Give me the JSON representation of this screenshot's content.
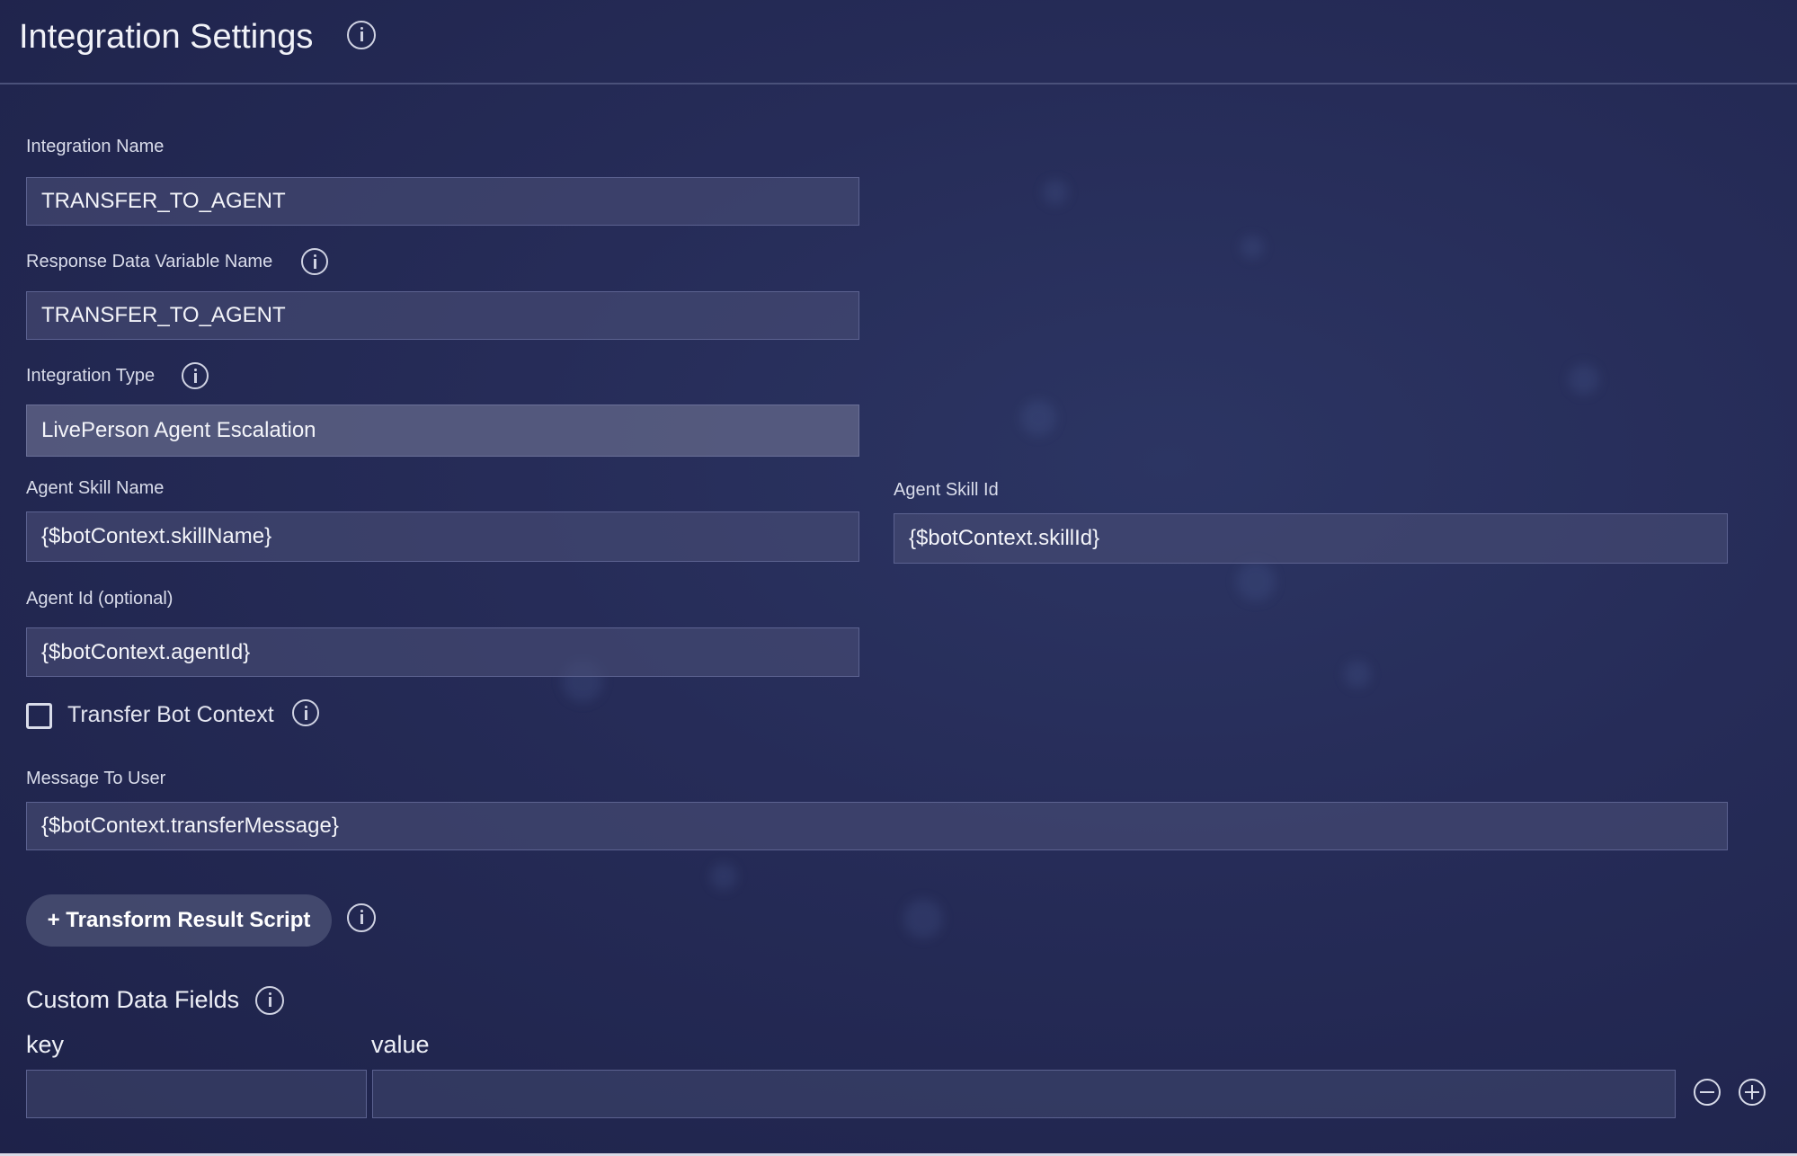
{
  "header": {
    "title": "Integration Settings"
  },
  "form": {
    "integration_name": {
      "label": "Integration Name",
      "value": "TRANSFER_TO_AGENT"
    },
    "response_variable": {
      "label": "Response Data Variable Name",
      "value": "TRANSFER_TO_AGENT"
    },
    "integration_type": {
      "label": "Integration Type",
      "value": "LivePerson Agent Escalation"
    },
    "agent_skill_name": {
      "label": "Agent Skill Name",
      "value": "{$botContext.skillName}"
    },
    "agent_skill_id": {
      "label": "Agent Skill Id",
      "value": "{$botContext.skillId}"
    },
    "agent_id": {
      "label": "Agent Id (optional)",
      "value": "{$botContext.agentId}"
    },
    "transfer_bot_context": {
      "label": "Transfer Bot Context",
      "checked": false
    },
    "message_to_user": {
      "label": "Message To User",
      "value": "{$botContext.transferMessage}"
    },
    "transform_button": {
      "label": "+ Transform Result Script"
    }
  },
  "custom_fields": {
    "title": "Custom Data Fields",
    "key_header": "key",
    "value_header": "value",
    "rows": [
      {
        "key": "",
        "value": ""
      }
    ]
  },
  "colors": {
    "background": "#262c58",
    "field_bg": "#484e76",
    "select_bg": "#5c6084",
    "text": "#f3f4f9",
    "label": "#d9dcea"
  }
}
